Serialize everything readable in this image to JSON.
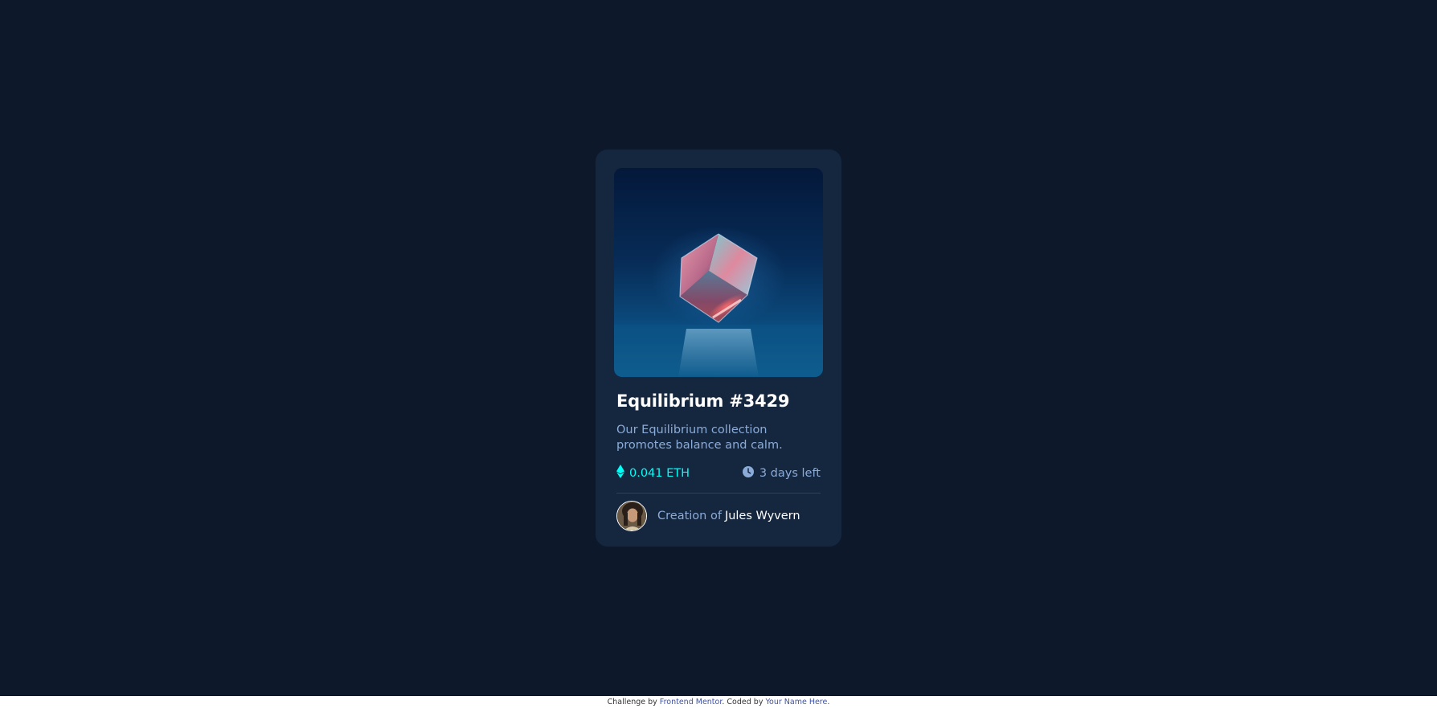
{
  "card": {
    "image_alt": "Equilibrium cube",
    "title": "Equilibrium #3429",
    "description": "Our Equilibrium collection promotes balance and calm.",
    "price": "0.041 ETH",
    "price_icon": "ethereum-icon",
    "time_left": "3 days left",
    "time_icon": "clock-icon",
    "creator_prefix": "Creation of",
    "creator_name": "Jules Wyvern"
  },
  "attribution": {
    "prefix": "Challenge by",
    "challenge_link": "Frontend Mentor",
    "middle": ". Coded by",
    "author_link": "Your Name Here",
    "suffix": "."
  },
  "colors": {
    "page_bg": "#0d192b",
    "card_bg": "#15263f",
    "accent_cyan": "#00fff7",
    "soft_blue": "#8bacd9",
    "white": "#ffffff"
  }
}
